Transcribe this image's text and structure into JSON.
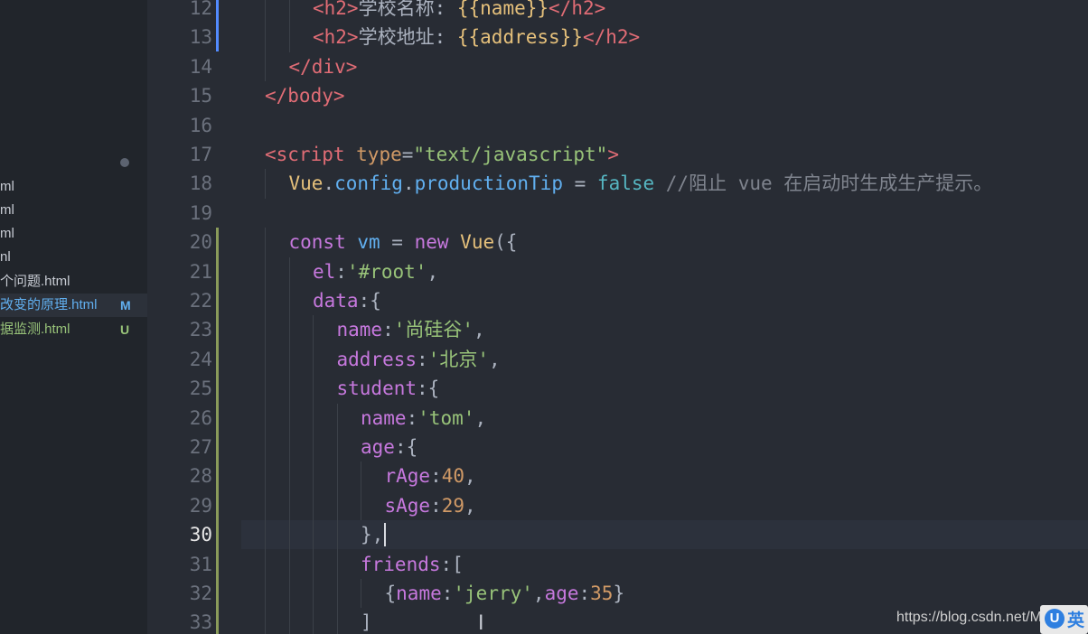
{
  "sidebar": {
    "files": [
      {
        "name": "ml",
        "badge": ""
      },
      {
        "name": "ml",
        "badge": ""
      },
      {
        "name": "ml",
        "badge": ""
      },
      {
        "name": "nl",
        "badge": ""
      },
      {
        "name": "个问题.html",
        "badge": ""
      },
      {
        "name": "改变的原理.html",
        "badge": "M"
      },
      {
        "name": "据监测.html",
        "badge": "U"
      }
    ]
  },
  "editor": {
    "current_line": 30,
    "lines": [
      {
        "n": "12",
        "indent": 2,
        "tokens": [
          [
            "tag",
            "<h2>"
          ],
          [
            "plain",
            "学校名称: "
          ],
          [
            "mus",
            "{{name}}"
          ],
          [
            "tag",
            "</h2>"
          ]
        ]
      },
      {
        "n": "13",
        "indent": 2,
        "tokens": [
          [
            "tag",
            "<h2>"
          ],
          [
            "plain",
            "学校地址: "
          ],
          [
            "mus",
            "{{address}}"
          ],
          [
            "tag",
            "</h2>"
          ]
        ]
      },
      {
        "n": "14",
        "indent": 1,
        "tokens": [
          [
            "tag",
            "</div>"
          ]
        ]
      },
      {
        "n": "15",
        "indent": 0,
        "tokens": [
          [
            "tag",
            "</body>"
          ]
        ]
      },
      {
        "n": "16",
        "indent": 0,
        "tokens": []
      },
      {
        "n": "17",
        "indent": 0,
        "tokens": [
          [
            "tag",
            "<script "
          ],
          [
            "attr",
            "type"
          ],
          [
            "plain",
            "="
          ],
          [
            "str",
            "\"text/javascript\""
          ],
          [
            "tag",
            ">"
          ]
        ]
      },
      {
        "n": "18",
        "indent": 1,
        "tokens": [
          [
            "fn",
            "Vue"
          ],
          [
            "plain",
            "."
          ],
          [
            "prop",
            "config"
          ],
          [
            "plain",
            "."
          ],
          [
            "prop",
            "productionTip"
          ],
          [
            "plain",
            " = "
          ],
          [
            "bool",
            "false"
          ],
          [
            "cmt",
            " //阻止 vue 在启动时生成生产提示。"
          ]
        ]
      },
      {
        "n": "19",
        "indent": 0,
        "tokens": []
      },
      {
        "n": "20",
        "indent": 1,
        "tokens": [
          [
            "kw",
            "const "
          ],
          [
            "prop",
            "vm"
          ],
          [
            "plain",
            " = "
          ],
          [
            "kw",
            "new "
          ],
          [
            "fn",
            "Vue"
          ],
          [
            "plain",
            "({"
          ]
        ]
      },
      {
        "n": "21",
        "indent": 2,
        "tokens": [
          [
            "key",
            "el"
          ],
          [
            "plain",
            ":"
          ],
          [
            "str",
            "'#root'"
          ],
          [
            "plain",
            ","
          ]
        ]
      },
      {
        "n": "22",
        "indent": 2,
        "tokens": [
          [
            "key",
            "data"
          ],
          [
            "plain",
            ":{"
          ]
        ]
      },
      {
        "n": "23",
        "indent": 3,
        "tokens": [
          [
            "key",
            "name"
          ],
          [
            "plain",
            ":"
          ],
          [
            "str",
            "'尚硅谷'"
          ],
          [
            "plain",
            ","
          ]
        ]
      },
      {
        "n": "24",
        "indent": 3,
        "tokens": [
          [
            "key",
            "address"
          ],
          [
            "plain",
            ":"
          ],
          [
            "str",
            "'北京'"
          ],
          [
            "plain",
            ","
          ]
        ]
      },
      {
        "n": "25",
        "indent": 3,
        "tokens": [
          [
            "key",
            "student"
          ],
          [
            "plain",
            ":{"
          ]
        ]
      },
      {
        "n": "26",
        "indent": 4,
        "tokens": [
          [
            "key",
            "name"
          ],
          [
            "plain",
            ":"
          ],
          [
            "str",
            "'tom'"
          ],
          [
            "plain",
            ","
          ]
        ]
      },
      {
        "n": "27",
        "indent": 4,
        "tokens": [
          [
            "key",
            "age"
          ],
          [
            "plain",
            ":{"
          ]
        ]
      },
      {
        "n": "28",
        "indent": 5,
        "tokens": [
          [
            "key",
            "rAge"
          ],
          [
            "plain",
            ":"
          ],
          [
            "num",
            "40"
          ],
          [
            "plain",
            ","
          ]
        ]
      },
      {
        "n": "29",
        "indent": 5,
        "tokens": [
          [
            "key",
            "sAge"
          ],
          [
            "plain",
            ":"
          ],
          [
            "num",
            "29"
          ],
          [
            "plain",
            ","
          ]
        ]
      },
      {
        "n": "30",
        "indent": 4,
        "tokens": [
          [
            "plain",
            "},"
          ]
        ]
      },
      {
        "n": "31",
        "indent": 4,
        "tokens": [
          [
            "key",
            "friends"
          ],
          [
            "plain",
            ":["
          ]
        ]
      },
      {
        "n": "32",
        "indent": 5,
        "tokens": [
          [
            "plain",
            "{"
          ],
          [
            "key",
            "name"
          ],
          [
            "plain",
            ":"
          ],
          [
            "str",
            "'jerry'"
          ],
          [
            "plain",
            ","
          ],
          [
            "key",
            "age"
          ],
          [
            "plain",
            ":"
          ],
          [
            "num",
            "35"
          ],
          [
            "plain",
            "}"
          ]
        ]
      },
      {
        "n": "33",
        "indent": 4,
        "tokens": [
          [
            "plain",
            "]"
          ]
        ]
      }
    ]
  },
  "watermark": {
    "text": "https://blog.csdn.net/M"
  },
  "ime": {
    "logo": "U",
    "label": "英"
  }
}
